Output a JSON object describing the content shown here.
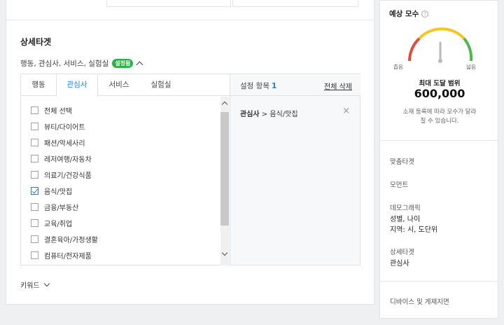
{
  "detail_section": {
    "title": "상세타겟",
    "summary_text": "행동, 관심사, 서비스, 실험실",
    "badge": "설정됨",
    "tabs": [
      {
        "label": "행동",
        "active": false
      },
      {
        "label": "관심사",
        "active": true
      },
      {
        "label": "서비스",
        "active": false
      },
      {
        "label": "실험실",
        "active": false
      }
    ],
    "categories": [
      {
        "label": "전체 선택",
        "checked": false
      },
      {
        "label": "뷰티/다이어트",
        "checked": false
      },
      {
        "label": "패션/악세사리",
        "checked": false
      },
      {
        "label": "레저여행/자동차",
        "checked": false
      },
      {
        "label": "의료기/건강식품",
        "checked": false
      },
      {
        "label": "음식/맛집",
        "checked": true
      },
      {
        "label": "금융/부동산",
        "checked": false
      },
      {
        "label": "교육/취업",
        "checked": false
      },
      {
        "label": "결혼육아/가정생활",
        "checked": false
      },
      {
        "label": "컴퓨터/전자제품",
        "checked": false
      }
    ],
    "selected": {
      "title": "설정 항목",
      "count": "1",
      "clear_all": "전체 삭제",
      "item_category": "관심사",
      "item_separator": " > ",
      "item_value": "음식/맛집",
      "remove_icon": "×"
    },
    "keyword_label": "키워드"
  },
  "estimate": {
    "title": "예상 모수",
    "help_icon": "?",
    "gauge_level": 0.5,
    "narrow_label": "좁음",
    "wide_label": "넓음",
    "reach_label": "최대 도달 범위",
    "reach_value": "600,000",
    "note": "소재 등록에 따라 모수가 달라질 수 있습니다.",
    "colors": {
      "red": "#e24a3b",
      "yellow": "#f3c623",
      "green": "#4fb84a"
    }
  },
  "summary": {
    "custom_target_label": "맞춤타겟",
    "moment_label": "모먼트",
    "demographic_label": "데모그래픽",
    "demographic_value_1": "성별, 나이",
    "demographic_value_2": "지역: 시, 도단위",
    "detail_target_label": "상세타겟",
    "detail_target_value": "관심사",
    "device_label": "디바이스 및 게재지면"
  }
}
